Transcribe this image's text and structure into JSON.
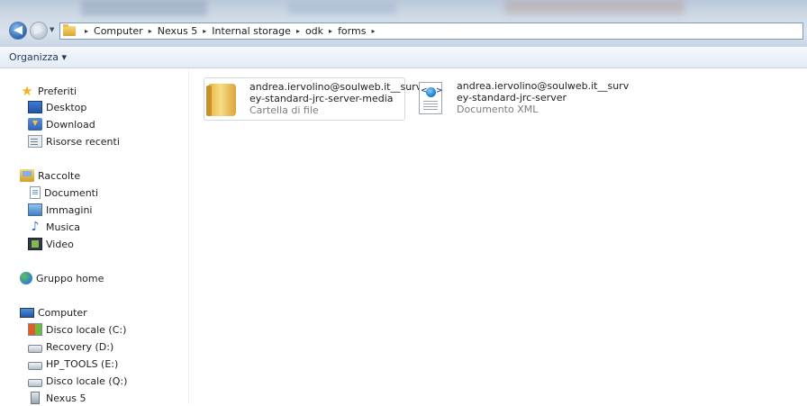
{
  "address": {
    "crumbs": [
      "Computer",
      "Nexus 5",
      "Internal storage",
      "odk",
      "forms"
    ],
    "separator": "▸",
    "back_glyph": "◀",
    "forward_glyph": "▶",
    "history_glyph": "▼"
  },
  "toolbar": {
    "organize_label": "Organizza ▾"
  },
  "sidebar": {
    "favorites": {
      "label": "Preferiti",
      "icon": "star-icon"
    },
    "favorites_items": [
      {
        "label": "Desktop",
        "icon": "desktop-icon"
      },
      {
        "label": "Download",
        "icon": "download-icon"
      },
      {
        "label": "Risorse recenti",
        "icon": "recent-places-icon"
      }
    ],
    "libraries": {
      "label": "Raccolte",
      "icon": "libraries-icon"
    },
    "libraries_items": [
      {
        "label": "Documenti",
        "icon": "documents-icon"
      },
      {
        "label": "Immagini",
        "icon": "pictures-icon"
      },
      {
        "label": "Musica",
        "icon": "music-icon"
      },
      {
        "label": "Video",
        "icon": "video-icon"
      }
    ],
    "homegroup": {
      "label": "Gruppo home",
      "icon": "homegroup-icon"
    },
    "computer": {
      "label": "Computer",
      "icon": "computer-icon"
    },
    "computer_items": [
      {
        "label": "Disco locale (C:)",
        "icon": "windows-drive-icon"
      },
      {
        "label": "Recovery (D:)",
        "icon": "drive-icon"
      },
      {
        "label": "HP_TOOLS (E:)",
        "icon": "drive-icon"
      },
      {
        "label": "Disco locale (Q:)",
        "icon": "drive-icon"
      },
      {
        "label": "Nexus 5",
        "icon": "portable-device-icon"
      }
    ]
  },
  "files": [
    {
      "name_line1": "andrea.iervolino@soulweb.it__surv",
      "name_line2": "ey-standard-jrc-server-media",
      "type": "Cartella di file",
      "icon": "folder-icon"
    },
    {
      "name_line1": "andrea.iervolino@soulweb.it__surv",
      "name_line2": "ey-standard-jrc-server",
      "type": "Documento XML",
      "icon": "xml-document-icon"
    }
  ],
  "colors": {
    "address_border": "#7f9db9",
    "toolbar_text": "#1e395b",
    "secondary_text": "#7c7c7c",
    "selection_border": "#cfd8e3"
  }
}
